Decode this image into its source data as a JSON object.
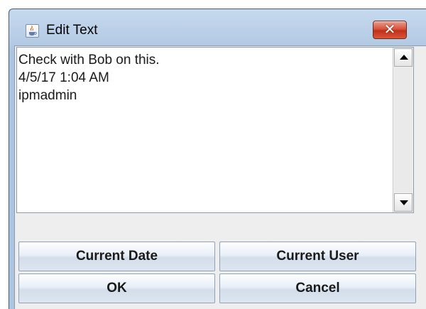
{
  "window": {
    "title": "Edit Text",
    "icon": "java-cup-icon",
    "close_label": "✕"
  },
  "text_area": {
    "lines": [
      "Check with Bob on this.",
      "4/5/17 1:04 AM",
      "ipmadmin"
    ]
  },
  "buttons": {
    "current_date": "Current Date",
    "current_user": "Current User",
    "ok": "OK",
    "cancel": "Cancel"
  },
  "colors": {
    "title_bar": "#b7cde6",
    "close_button": "#c9402a",
    "content_background": "#eeeeee",
    "button_face": "#e8eff7"
  }
}
